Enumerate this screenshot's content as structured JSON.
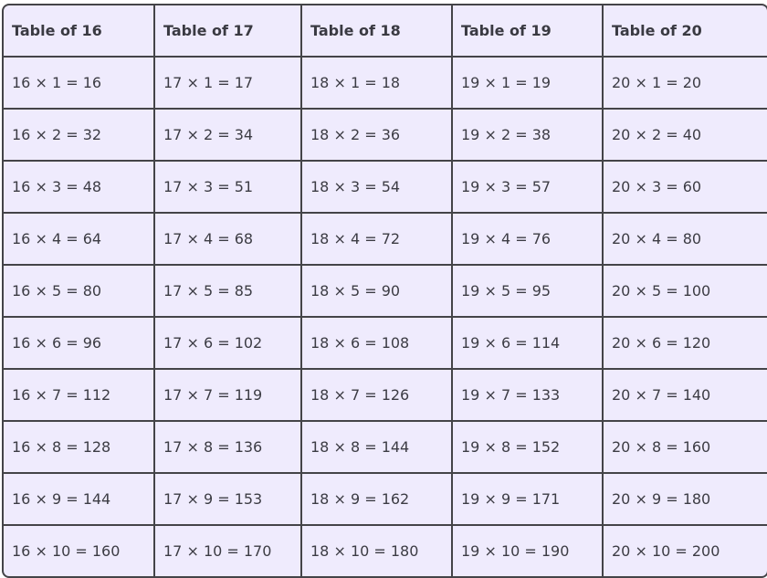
{
  "headers": [
    "Table of 16",
    "Table of 17",
    "Table of 18",
    "Table of 19",
    "Table of 20"
  ],
  "rows": [
    [
      "16 × 1 = 16",
      "17 × 1 = 17",
      "18 × 1 = 18",
      "19 × 1 = 19",
      "20 × 1 = 20"
    ],
    [
      "16 × 2 = 32",
      "17 × 2 = 34",
      "18 × 2 = 36",
      "19 × 2 = 38",
      "20 × 2 = 40"
    ],
    [
      "16 × 3 = 48",
      "17 × 3 = 51",
      "18 × 3 = 54",
      "19 × 3 = 57",
      "20 × 3 = 60"
    ],
    [
      "16 × 4 = 64",
      "17 × 4 = 68",
      "18 × 4 = 72",
      "19 × 4 = 76",
      "20 × 4 = 80"
    ],
    [
      "16 × 5 = 80",
      "17 × 5 = 85",
      "18 × 5 = 90",
      "19 × 5 = 95",
      "20 × 5 = 100"
    ],
    [
      "16 × 6 = 96",
      "17 × 6 = 102",
      "18 × 6 = 108",
      "19 × 6 = 114",
      "20 × 6 = 120"
    ],
    [
      "16 × 7 = 112",
      "17 × 7 = 119",
      "18 × 7 = 126",
      "19 × 7 = 133",
      "20 × 7 = 140"
    ],
    [
      "16 × 8 = 128",
      "17 × 8 = 136",
      "18 × 8 = 144",
      "19 × 8 = 152",
      "20 × 8 = 160"
    ],
    [
      "16 × 9 = 144",
      "17 × 9 = 153",
      "18 × 9 = 162",
      "19 × 9 = 171",
      "20 × 9 = 180"
    ],
    [
      "16 × 10 = 160",
      "17 × 10 = 170",
      "18 × 10 = 180",
      "19 × 10 = 190",
      "20 × 10 = 200"
    ]
  ]
}
